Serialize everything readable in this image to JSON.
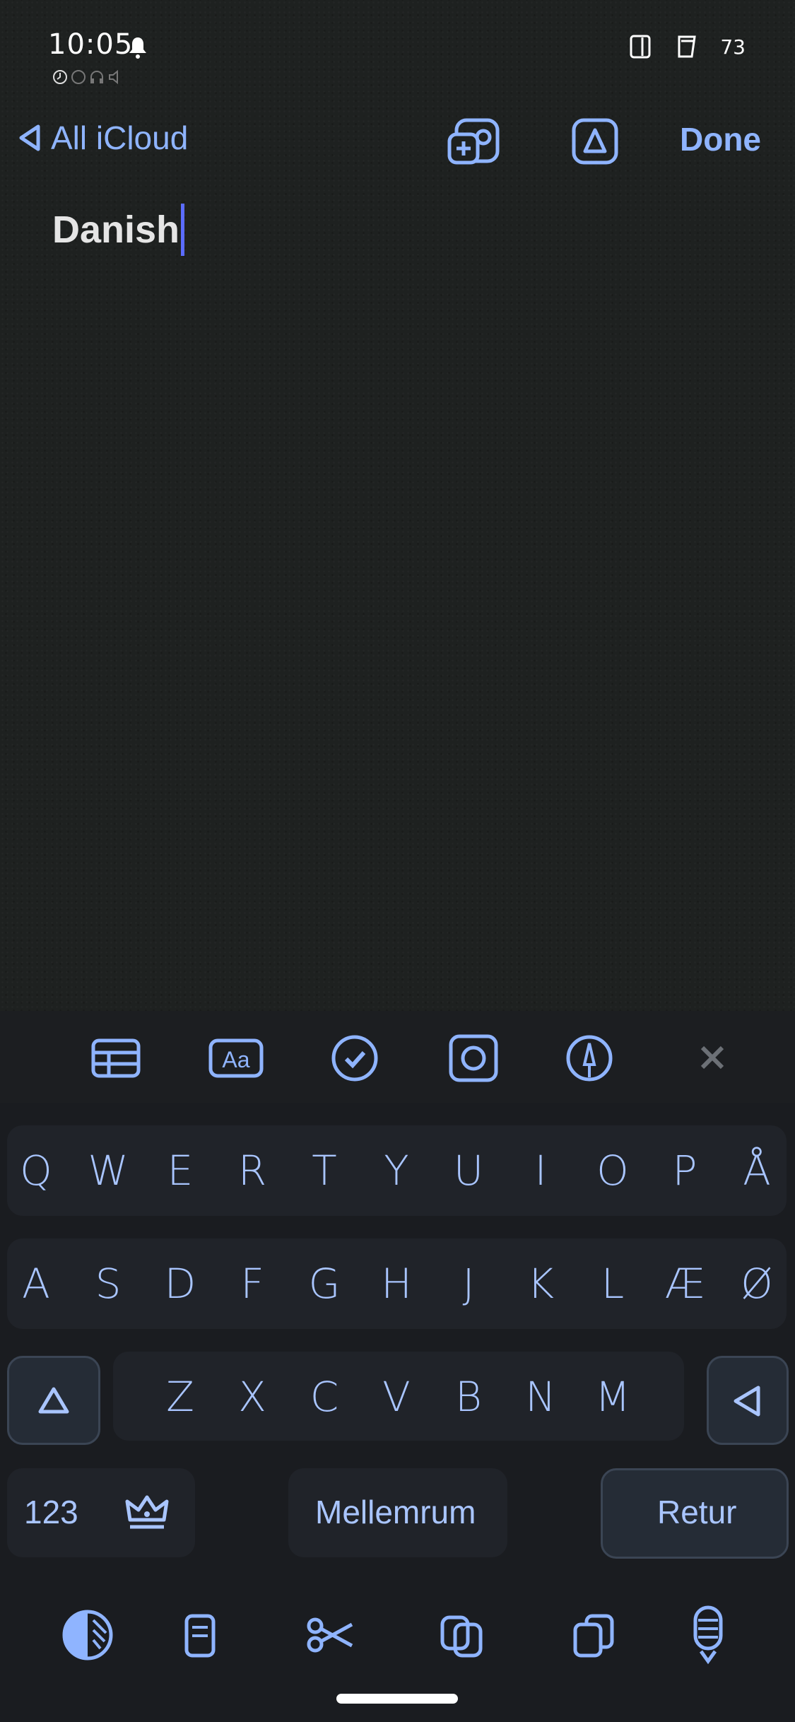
{
  "status_bar": {
    "time": "10:05",
    "battery": "73",
    "icons": [
      "bell-icon",
      "dual-sim-icon",
      "tablet-icon"
    ]
  },
  "nav": {
    "back_label": "All iCloud",
    "done_label": "Done",
    "icons": [
      "share-collaborate-icon",
      "markup-icon"
    ]
  },
  "note": {
    "title": "Danish"
  },
  "format_toolbar": {
    "icons": [
      "table-icon",
      "text-format-icon",
      "checklist-icon",
      "camera-icon",
      "pen-icon",
      "close-icon"
    ]
  },
  "keyboard": {
    "row1": [
      "Q",
      "W",
      "E",
      "R",
      "T",
      "Y",
      "U",
      "I",
      "O",
      "P",
      "Å"
    ],
    "row2": [
      "A",
      "S",
      "D",
      "F",
      "G",
      "H",
      "J",
      "K",
      "L",
      "Æ",
      "Ø"
    ],
    "row3": [
      "Z",
      "X",
      "C",
      "V",
      "B",
      "N",
      "M"
    ],
    "numbers_label": "123",
    "space_label": "Mellemrum",
    "return_label": "Retur"
  },
  "bottom_tools": {
    "icons": [
      "theme-icon",
      "clipboard-icon",
      "scissors-icon",
      "copy-icon",
      "paste-icon",
      "microphone-icon"
    ]
  },
  "colors": {
    "accent": "#8fb4ff",
    "background": "#1e2120",
    "keyboard": "#1a1c20",
    "caret": "#5b6cff"
  }
}
